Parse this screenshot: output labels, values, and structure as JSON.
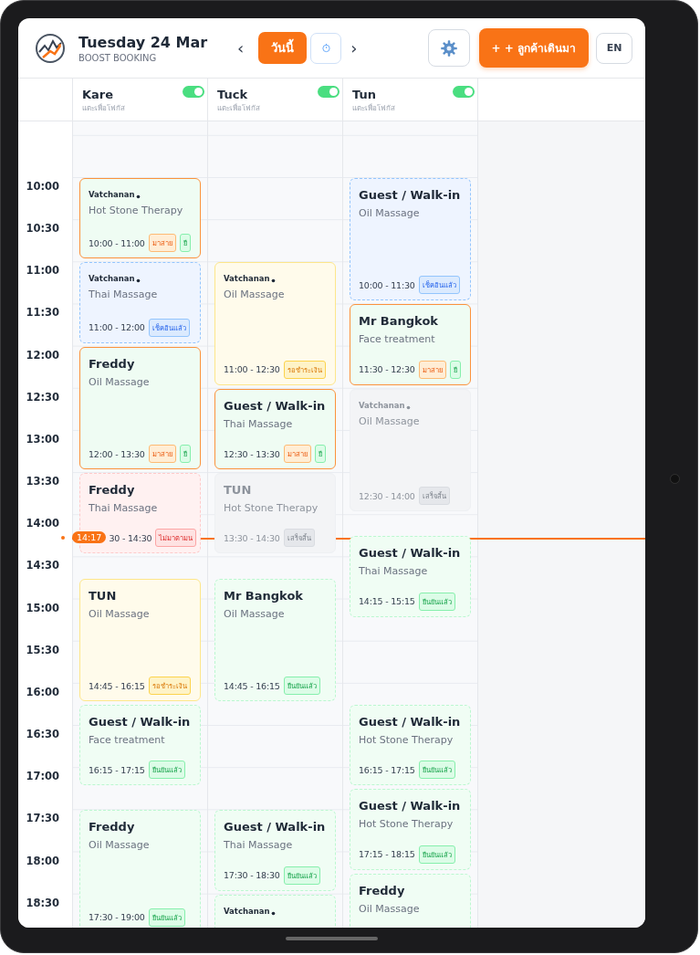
{
  "header": {
    "title": "Tuesday 24 Mar",
    "subtitle": "BOOST BOOKING",
    "prev": "‹",
    "today": "วันนี้",
    "next": "›",
    "walk_in": "+ + ลูกค้าเดินมา",
    "language": "EN"
  },
  "columns": [
    {
      "name": "Kare",
      "hint": "แตะเพื่อโฟกัส",
      "on": true,
      "bookings": [
        {
          "kind": "late",
          "member": true,
          "name": "Vatchanan",
          "service": "Hot Stone Therapy",
          "time": "10:00 - 11:00",
          "tags": [
            {
              "kind": "late",
              "text": "มาสาย"
            },
            {
              "kind": "confirmed",
              "text": "ยื"
            }
          ]
        },
        {
          "kind": "checked_in",
          "member": true,
          "name": "Vatchanan",
          "service": "Thai Massage",
          "time": "11:00 - 12:00",
          "tags": [
            {
              "kind": "checked_in",
              "text": "เช็คอินแล้ว"
            }
          ]
        },
        {
          "kind": "late",
          "member": false,
          "name": "Freddy",
          "service": "Oil Massage",
          "time": "12:00 - 13:30",
          "tags": [
            {
              "kind": "late",
              "text": "มาสาย"
            },
            {
              "kind": "confirmed",
              "text": "ยื"
            }
          ]
        },
        {
          "kind": "no_show",
          "member": false,
          "name": "Freddy",
          "service": "Thai Massage",
          "time": "30 - 14:30",
          "tags": [
            {
              "kind": "no_show",
              "text": "ไม่มาตามน"
            }
          ]
        },
        {
          "kind": "pending",
          "member": false,
          "name": "TUN",
          "service": "Oil Massage",
          "time": "14:45 - 16:15",
          "tags": [
            {
              "kind": "pending",
              "text": "รอชำระเงิน"
            }
          ]
        },
        {
          "kind": "confirmed",
          "member": false,
          "name": "Guest / Walk-in",
          "service": "Face treatment",
          "time": "16:15 - 17:15",
          "tags": [
            {
              "kind": "confirmed",
              "text": "ยืนยันแล้ว"
            }
          ]
        },
        {
          "kind": "confirmed",
          "member": false,
          "name": "Freddy",
          "service": "Oil Massage",
          "time": "17:30 - 19:00",
          "tags": [
            {
              "kind": "confirmed",
              "text": "ยืนยันแล้ว"
            }
          ]
        }
      ]
    },
    {
      "name": "Tuck",
      "hint": "แตะเพื่อโฟกัส",
      "on": true,
      "bookings": [
        {
          "kind": "pending",
          "member": true,
          "name": "Vatchanan",
          "service": "Oil Massage",
          "time": "11:00 - 12:30",
          "tags": [
            {
              "kind": "pending",
              "text": "รอชำระเงิน"
            }
          ]
        },
        {
          "kind": "late",
          "member": false,
          "name": "Guest / Walk-in",
          "service": "Thai Massage",
          "time": "12:30 - 13:30",
          "tags": [
            {
              "kind": "late",
              "text": "มาสาย"
            },
            {
              "kind": "confirmed",
              "text": "ยื"
            }
          ]
        },
        {
          "kind": "done",
          "member": false,
          "name": "TUN",
          "service": "Hot Stone Therapy",
          "time": "13:30 - 14:30",
          "tags": [
            {
              "kind": "done",
              "text": "เสร็จสิ้น"
            }
          ]
        },
        {
          "kind": "confirmed",
          "member": false,
          "name": "Mr Bangkok",
          "service": "Oil Massage",
          "time": "14:45 - 16:15",
          "tags": [
            {
              "kind": "confirmed",
              "text": "ยืนยันแล้ว"
            }
          ]
        },
        {
          "kind": "confirmed",
          "member": false,
          "name": "Guest / Walk-in",
          "service": "Thai Massage",
          "time": "17:30 - 18:30",
          "tags": [
            {
              "kind": "confirmed",
              "text": "ยืนยันแล้ว"
            }
          ]
        },
        {
          "kind": "confirmed",
          "member": true,
          "name": "Vatchanan"
        }
      ]
    },
    {
      "name": "Tun",
      "hint": "แตะเพื่อโฟกัส",
      "on": true,
      "bookings": [
        {
          "kind": "checked_in",
          "member": false,
          "name": "Guest / Walk-in",
          "service": "Oil Massage",
          "time": "10:00 - 11:30",
          "tags": [
            {
              "kind": "checked_in",
              "text": "เช็คอินแล้ว"
            }
          ]
        },
        {
          "kind": "late",
          "member": false,
          "name": "Mr Bangkok",
          "service": "Face treatment",
          "time": "11:30 - 12:30",
          "tags": [
            {
              "kind": "late",
              "text": "มาสาย"
            },
            {
              "kind": "confirmed",
              "text": "ยื"
            }
          ]
        },
        {
          "kind": "done",
          "member": true,
          "name": "Vatchanan",
          "service": "Oil Massage",
          "time": "12:30 - 14:00",
          "tags": [
            {
              "kind": "done",
              "text": "เสร็จสิ้น"
            }
          ]
        },
        {
          "kind": "confirmed",
          "member": false,
          "name": "Guest / Walk-in",
          "service": "Thai Massage",
          "time": "14:15 - 15:15",
          "tags": [
            {
              "kind": "confirmed",
              "text": "ยืนยันแล้ว"
            }
          ]
        },
        {
          "kind": "confirmed",
          "member": false,
          "name": "Guest / Walk-in",
          "service": "Hot Stone Therapy",
          "time": "16:15 - 17:15",
          "tags": [
            {
              "kind": "confirmed",
              "text": "ยืนยันแล้ว"
            }
          ]
        },
        {
          "kind": "confirmed",
          "member": false,
          "name": "Guest / Walk-in",
          "service": "Hot Stone Therapy",
          "time": "17:15 - 18:15",
          "tags": [
            {
              "kind": "confirmed",
              "text": "ยืนยันแล้ว"
            }
          ]
        },
        {
          "kind": "confirmed",
          "member": false,
          "name": "Freddy",
          "service": "Oil Massage"
        }
      ]
    }
  ],
  "times": [
    "10:00",
    "10:30",
    "11:00",
    "11:30",
    "12:00",
    "12:30",
    "13:00",
    "13:30",
    "14:00",
    "14:30",
    "15:00",
    "15:30",
    "16:00",
    "16:30",
    "17:00",
    "17:30",
    "18:00",
    "18:30"
  ],
  "now": "14:17"
}
